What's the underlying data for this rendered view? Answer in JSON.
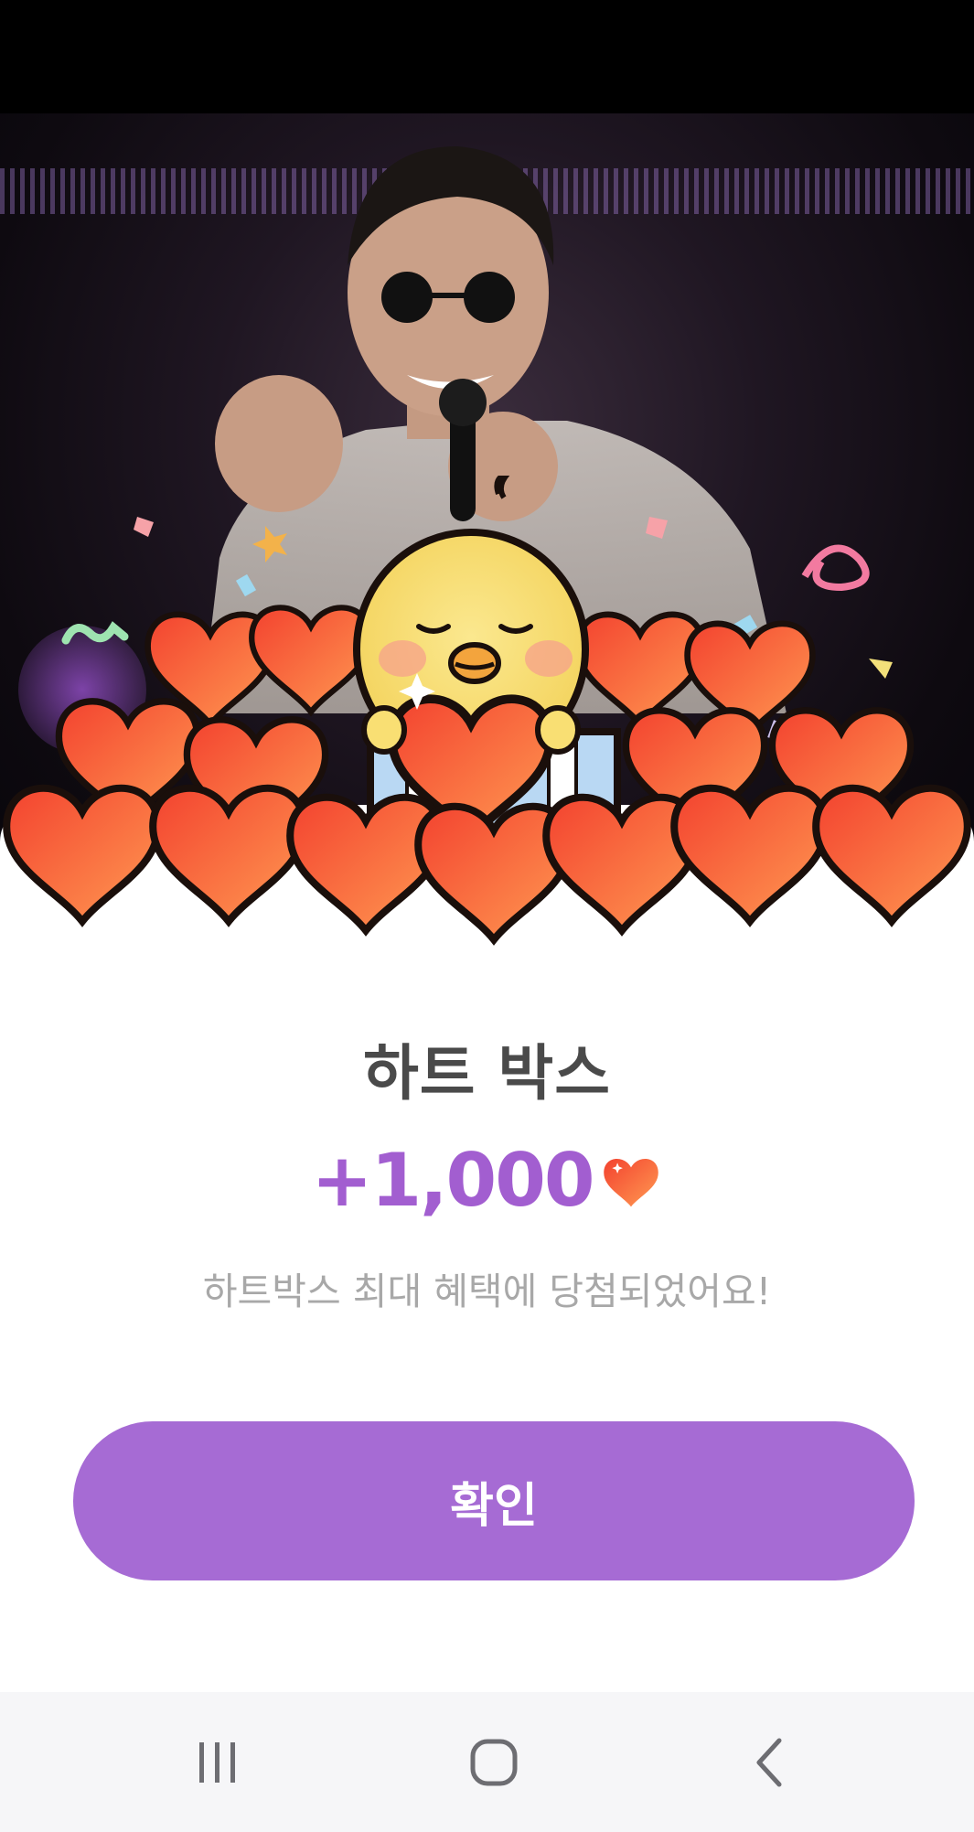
{
  "reward": {
    "title": "하트 박스",
    "amount": "+1,000",
    "message": "하트박스 최대 혜택에 당첨되었어요!",
    "confirm_label": "확인"
  },
  "colors": {
    "accent_purple": "#a66bd4",
    "amount_purple": "#a25ed0",
    "title_gray": "#4a4a4a",
    "message_gray": "#a8a8a8",
    "heart_red": "#f5533b",
    "chick_yellow": "#f9df73"
  },
  "icons": {
    "amount": "heart-icon",
    "nav_recents": "recents-icon",
    "nav_home": "home-icon",
    "nav_back": "back-icon"
  }
}
